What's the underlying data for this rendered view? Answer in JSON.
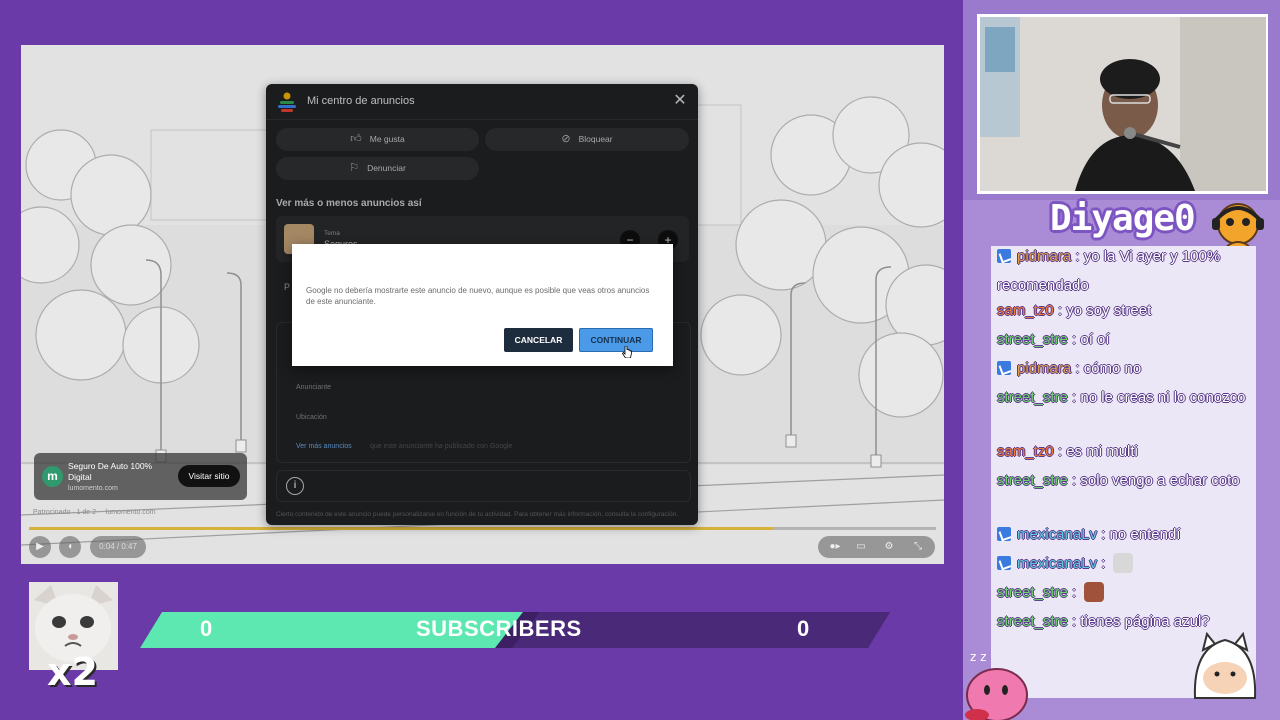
{
  "ad_center": {
    "title": "Mi centro de anuncios",
    "like_label": "Me gusta",
    "block_label": "Bloquear",
    "report_label": "Denunciar",
    "section_title": "Ver más o menos anuncios así",
    "topic_label": "Tema",
    "topic_name": "Seguros",
    "hidden_row_label": "P",
    "advertiser_label": "Anunciante",
    "location_label": "Ubicación",
    "more_ads_link": "Ver más anuncios",
    "more_ads_rest": "que este anunciante ha publicado con Google",
    "footnote": "Cierto contenido de este anuncio puede personalizarse en función de tu actividad. Para obtener más información, consulta la configuración."
  },
  "confirm_dialog": {
    "message": "Google no debería mostrarte este anuncio de nuevo, aunque es posible que veas otros anuncios de este anunciante.",
    "cancel_label": "CANCELAR",
    "continue_label": "CONTINUAR"
  },
  "video": {
    "ad_title": "Seguro De Auto 100% Digital",
    "ad_domain": "lumomento.com",
    "visit_label": "Visitar sitio",
    "ad_meta": "Patrocinado · 1 de 2     lumomento.com",
    "time": "0:04 / 0:47",
    "progress_fraction": 0.82
  },
  "overlay": {
    "emote_multiplier": "x2",
    "subscribers_label": "SUBSCRIBERS",
    "subscribers_left": "0",
    "subscribers_right": "0",
    "streamer_name": "Diyage0"
  },
  "chat": [
    {
      "badge": true,
      "user": "pidmara",
      "user_color": "#e0a24a",
      "text": ": yo la Vi ayer y 100% recomendado"
    },
    {
      "badge": false,
      "user": "sam_tz0",
      "user_color": "#f07a3a",
      "text": ": yo soy street"
    },
    {
      "badge": false,
      "user": "street_stre",
      "user_color": "#6fd46f",
      "text": ": oí oí"
    },
    {
      "badge": true,
      "user": "pidmara",
      "user_color": "#e0a24a",
      "text": ": cómo no"
    },
    {
      "badge": false,
      "user": "street_stre",
      "user_color": "#6fd46f",
      "text": ": no le creas ni lo conozco"
    },
    {
      "badge": false,
      "user": "sam_tz0",
      "user_color": "#f07a3a",
      "text": ": es mi multi"
    },
    {
      "badge": false,
      "user": "street_stre",
      "user_color": "#6fd46f",
      "text": ": solo vengo a echar coto"
    },
    {
      "badge": true,
      "user": "mexicanaLv",
      "user_color": "#5fc9e0",
      "text": ": no entendí"
    },
    {
      "badge": true,
      "user": "mexicanaLv",
      "user_color": "#5fc9e0",
      "text": ":"
    },
    {
      "badge": false,
      "user": "street_stre",
      "user_color": "#6fd46f",
      "text": ":"
    },
    {
      "badge": false,
      "user": "street_stre",
      "user_color": "#6fd46f",
      "text": ": tienes página azul?"
    }
  ],
  "colors": {
    "background": "#6a3aa8",
    "chat_panel": "#a98bd6",
    "sub_green": "#5ce8b0",
    "sub_dark": "#3d1f63",
    "continue_button": "#4a9ae8",
    "cancel_button": "#1e2d3d"
  },
  "icons": [
    "thumbs-up-icon",
    "block-icon",
    "flag-icon",
    "close-icon",
    "play-icon",
    "volume-icon",
    "settings-icon",
    "fullscreen-exit-icon",
    "info-icon",
    "cursor-icon"
  ]
}
